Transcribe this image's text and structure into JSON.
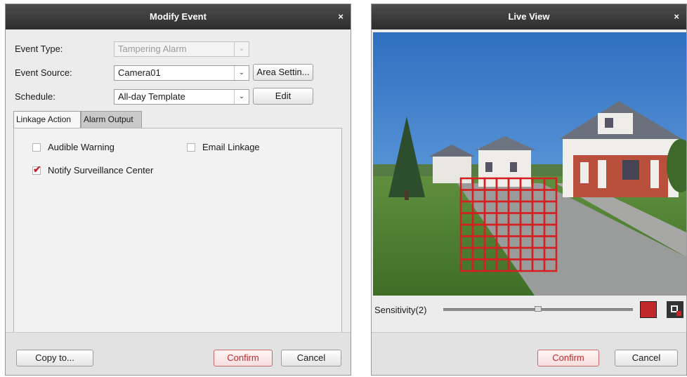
{
  "modify_event": {
    "title": "Modify Event",
    "close": "×",
    "event_type": {
      "label": "Event Type:",
      "value": "Tampering Alarm"
    },
    "event_source": {
      "label": "Event Source:",
      "value": "Camera01",
      "button": "Area Settin..."
    },
    "schedule": {
      "label": "Schedule:",
      "value": "All-day Template",
      "button": "Edit"
    },
    "tabs": [
      {
        "label": "Linkage Action",
        "active": true
      },
      {
        "label": "Alarm Output",
        "active": false
      }
    ],
    "linkage": {
      "audible_warning": {
        "label": "Audible Warning",
        "checked": false
      },
      "email_linkage": {
        "label": "Email Linkage",
        "checked": false
      },
      "notify_center": {
        "label": "Notify Surveillance Center",
        "checked": true
      }
    },
    "footer": {
      "copy_to": "Copy to...",
      "confirm": "Confirm",
      "cancel": "Cancel"
    }
  },
  "live_view": {
    "title": "Live View",
    "close": "×",
    "sensitivity_label": "Sensitivity(2)",
    "sensitivity_level": 2,
    "slider_position_fraction": 0.5,
    "grid_color": "#d42020",
    "footer": {
      "confirm": "Confirm",
      "cancel": "Cancel"
    }
  },
  "colors": {
    "accent": "#c0282a",
    "titlebar": "#333333"
  }
}
